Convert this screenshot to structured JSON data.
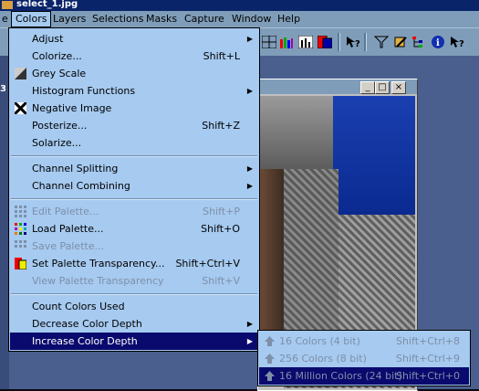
{
  "window": {
    "title": "select_1.jpg"
  },
  "menubar": {
    "items": [
      "e",
      "Colors",
      "Layers",
      "Selections",
      "Masks",
      "Capture",
      "Window",
      "Help"
    ]
  },
  "left_strip_label": "3",
  "colors_menu": {
    "items": [
      {
        "label": "Adjust",
        "shortcut": "",
        "submenu": true,
        "enabled": true,
        "icon": ""
      },
      {
        "label": "Colorize...",
        "shortcut": "Shift+L",
        "submenu": false,
        "enabled": true,
        "icon": ""
      },
      {
        "label": "Grey Scale",
        "shortcut": "",
        "submenu": false,
        "enabled": true,
        "icon": "greyscale-icon"
      },
      {
        "label": "Histogram Functions",
        "shortcut": "",
        "submenu": true,
        "enabled": true,
        "icon": ""
      },
      {
        "label": "Negative Image",
        "shortcut": "",
        "submenu": false,
        "enabled": true,
        "icon": "negative-icon"
      },
      {
        "label": "Posterize...",
        "shortcut": "Shift+Z",
        "submenu": false,
        "enabled": true,
        "icon": ""
      },
      {
        "label": "Solarize...",
        "shortcut": "",
        "submenu": false,
        "enabled": true,
        "icon": ""
      },
      {
        "label": "Channel Splitting",
        "shortcut": "",
        "submenu": true,
        "enabled": true,
        "icon": ""
      },
      {
        "label": "Channel Combining",
        "shortcut": "",
        "submenu": true,
        "enabled": true,
        "icon": ""
      },
      {
        "label": "Edit Palette...",
        "shortcut": "Shift+P",
        "submenu": false,
        "enabled": false,
        "icon": "palette-icon"
      },
      {
        "label": "Load Palette...",
        "shortcut": "Shift+O",
        "submenu": false,
        "enabled": true,
        "icon": "load-palette-icon"
      },
      {
        "label": "Save Palette...",
        "shortcut": "",
        "submenu": false,
        "enabled": false,
        "icon": "save-palette-icon"
      },
      {
        "label": "Set Palette Transparency...",
        "shortcut": "Shift+Ctrl+V",
        "submenu": false,
        "enabled": true,
        "icon": "transparency-icon"
      },
      {
        "label": "View Palette Transparency",
        "shortcut": "Shift+V",
        "submenu": false,
        "enabled": false,
        "icon": ""
      },
      {
        "label": "Count Colors Used",
        "shortcut": "",
        "submenu": false,
        "enabled": true,
        "icon": ""
      },
      {
        "label": "Decrease Color Depth",
        "shortcut": "",
        "submenu": true,
        "enabled": true,
        "icon": ""
      },
      {
        "label": "Increase Color Depth",
        "shortcut": "",
        "submenu": true,
        "enabled": true,
        "icon": "",
        "highlighted": true
      }
    ]
  },
  "increase_depth_submenu": {
    "items": [
      {
        "label": "16 Colors (4 bit)",
        "shortcut": "Shift+Ctrl+8",
        "icon": "up-arrow-icon"
      },
      {
        "label": "256 Colors (8 bit)",
        "shortcut": "Shift+Ctrl+9",
        "icon": "up-arrow-icon"
      },
      {
        "label": "16 Million Colors (24 bit)",
        "shortcut": "Shift+Ctrl+0",
        "icon": "up-arrow-icon",
        "highlighted": true
      }
    ]
  },
  "image_window": {
    "min_label": "_",
    "max_label": "□",
    "close_label": "×"
  },
  "colors": {
    "menu_bg": "#a6caf0",
    "highlight": "#0a0a6e",
    "disabled_text": "#7e8fa8",
    "bar": "#7f9db9"
  }
}
